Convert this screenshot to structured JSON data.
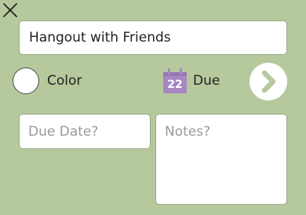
{
  "close_icon": "close-icon",
  "title_field": {
    "value": "Hangout with Friends"
  },
  "color_option": {
    "label": "Color",
    "icon": "radio-circle"
  },
  "due_option": {
    "label": "Due",
    "calendar_day": "22",
    "icon": "calendar-icon",
    "icon_color": "#a787c2"
  },
  "next_button": {
    "icon": "chevron-right-icon",
    "color": "#b6c99d"
  },
  "due_date": {
    "placeholder": "Due Date?"
  },
  "notes": {
    "placeholder": "Notes?"
  },
  "colors": {
    "background": "#b6c99d",
    "field": "#ffffff"
  }
}
